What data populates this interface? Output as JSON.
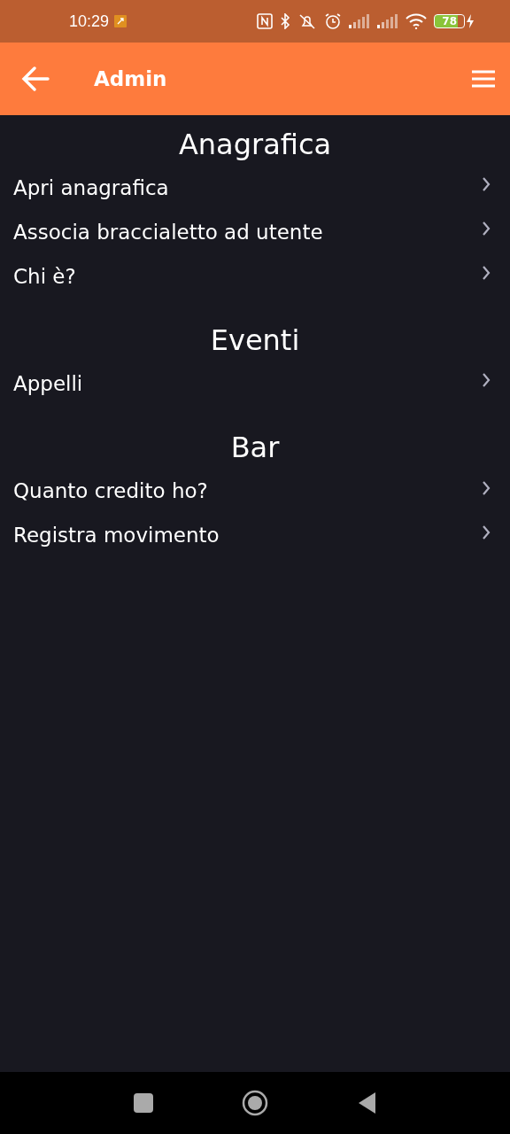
{
  "status_bar": {
    "time": "10:29",
    "battery": "78"
  },
  "app_bar": {
    "title": "Admin"
  },
  "sections": [
    {
      "title": "Anagrafica",
      "items": [
        {
          "label": "Apri anagrafica"
        },
        {
          "label": "Associa braccialetto ad utente"
        },
        {
          "label": "Chi è?"
        }
      ]
    },
    {
      "title": "Eventi",
      "items": [
        {
          "label": "Appelli"
        }
      ]
    },
    {
      "title": "Bar",
      "items": [
        {
          "label": "Quanto credito ho?"
        },
        {
          "label": "Registra movimento"
        }
      ]
    }
  ]
}
